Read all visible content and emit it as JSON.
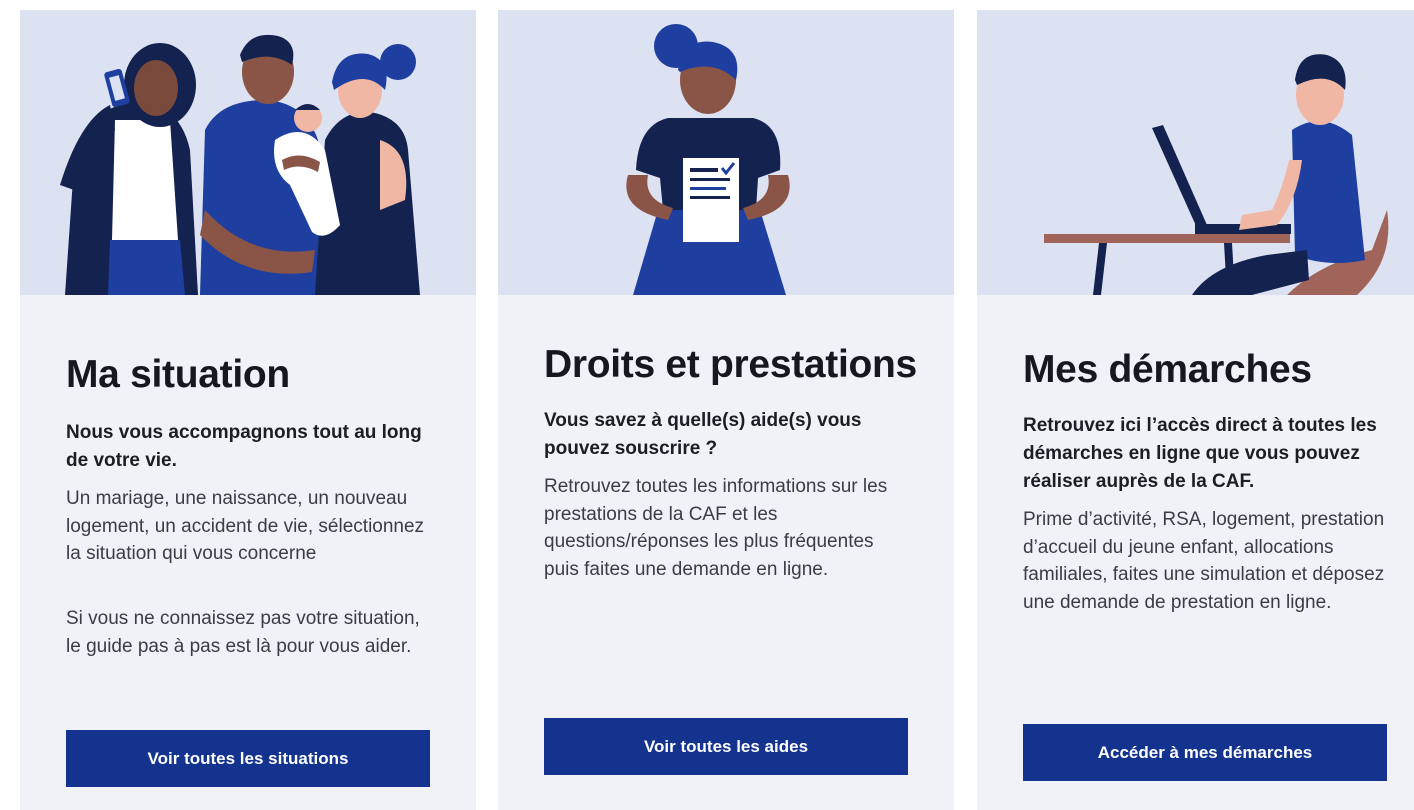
{
  "cards": [
    {
      "illustration": "family-with-baby-illustration",
      "title": "Ma situation",
      "lead": "Nous vous accompagnons tout au long de votre vie.",
      "paragraphs": [
        "Un mariage, une naissance, un nouveau logement, un accident de vie, sélectionnez la situation qui vous concerne",
        "Si vous ne connaissez pas votre situation, le guide pas à pas est là pour vous aider."
      ],
      "button_label": "Voir toutes les situations"
    },
    {
      "illustration": "woman-holding-document-illustration",
      "title": "Droits et prestations",
      "lead": "Vous savez à quelle(s) aide(s) vous pouvez souscrire ?",
      "paragraphs": [
        "Retrouvez toutes les informations sur les prestations de la CAF et les questions/réponses les plus fréquentes puis faites une demande en ligne."
      ],
      "button_label": "Voir toutes les aides"
    },
    {
      "illustration": "man-at-laptop-illustration",
      "title": "Mes démarches",
      "lead": "Retrouvez ici l’accès direct à toutes les démarches en ligne que vous pouvez réaliser auprès de la CAF.",
      "paragraphs": [
        "Prime d’activité, RSA, logement, prestation d’accueil du jeune enfant, allocations familiales, faites une simulation et déposez une demande de prestation en ligne."
      ],
      "button_label": "Accéder à mes démarches"
    }
  ],
  "colors": {
    "card_background": "#f1f2f8",
    "illustration_background": "#dde2f2",
    "button_background": "#14338f",
    "navy": "#13224f",
    "royal_blue": "#1e3ea0",
    "skin_brown": "#8a5546",
    "skin_light": "#f0b8a4"
  }
}
